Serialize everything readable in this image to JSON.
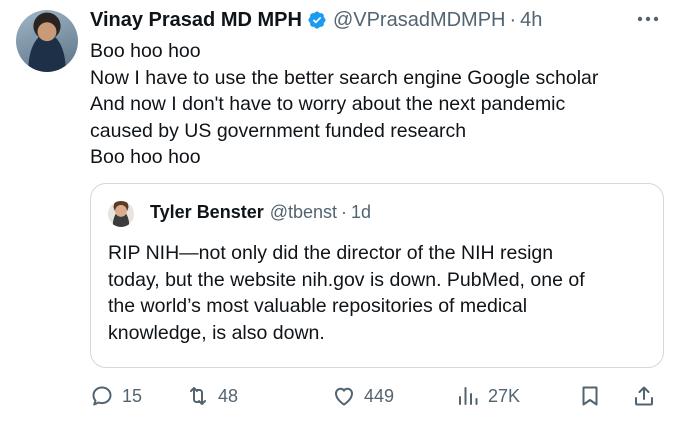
{
  "author": {
    "name": "Vinay Prasad MD MPH",
    "handle": "@VPrasadMDMPH",
    "separator": "·",
    "time": "4h"
  },
  "tweet_lines": [
    "Boo hoo hoo",
    "Now I have to use the better search engine Google scholar",
    "And now I don't have to worry about the next pandemic",
    "caused by US government funded research",
    "Boo hoo hoo"
  ],
  "quoted": {
    "name": "Tyler Benster",
    "handle": "@tbenst",
    "separator": "·",
    "time": "1d",
    "lines": [
      "RIP NIH—not only did the director of the NIH resign",
      "today, but the website nih.gov is down. PubMed, one of",
      "the world’s most valuable repositories of medical",
      "knowledge, is also down."
    ]
  },
  "actions": {
    "replies": "15",
    "reposts": "48",
    "likes": "449",
    "views": "27K"
  },
  "icons": {
    "verified": "verified-badge-icon",
    "more": "more-icon",
    "reply": "reply-icon",
    "repost": "repost-icon",
    "like": "heart-icon",
    "views": "views-icon",
    "bookmark": "bookmark-icon",
    "share": "share-icon"
  },
  "colors": {
    "verified": "#1d9bf0",
    "muted": "#536471",
    "text": "#0f1419",
    "border": "#cfd9de"
  }
}
